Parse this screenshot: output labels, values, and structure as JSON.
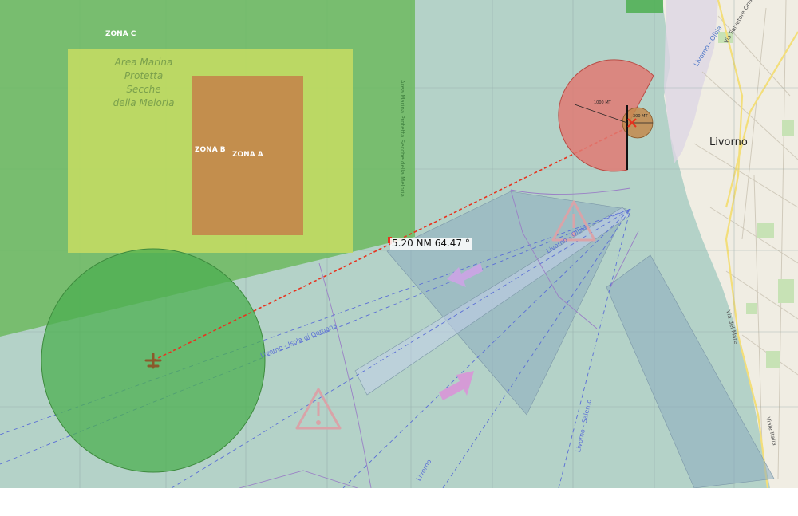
{
  "colors": {
    "sea": "#b4d2c8",
    "land": "#f0ede3",
    "protected_area": "#6ab85c",
    "zone_b": "#b9d460",
    "zone_a": "#c38a4c",
    "range_circle": "#4caf50",
    "danger_sector": "#e07a73",
    "measure_line": "#e8331f",
    "route_line": "#5b6fd6",
    "traffic_lane": "#8cabbf"
  },
  "icons": [
    "aircraft-icon",
    "warning-triangle-icon",
    "direction-arrow-icon",
    "drone-icon"
  ],
  "map": {
    "zones": {
      "zone_c": "ZONA C",
      "zone_b": "ZONA B",
      "zone_a": "ZONA A",
      "area_name_lines": [
        "Area Marina",
        "Protetta",
        "Secche",
        "della Meloria"
      ],
      "vertical_label": "Area Marina Protetta Secche della Meloria"
    },
    "measurement": {
      "distance": "5.20 NM",
      "bearing": "64.47 °"
    },
    "city": "Livorno",
    "radius_outer": "1000 MT",
    "radius_inner": "300 MT",
    "routes": [
      "Livorno - Isola di Gorgona",
      "Livorno - Olbia",
      "Livorno - Salerno",
      "Livorno"
    ],
    "streets": [
      "Via Salvatore Orlando",
      "Viale Italia",
      "Via del Mare"
    ]
  }
}
